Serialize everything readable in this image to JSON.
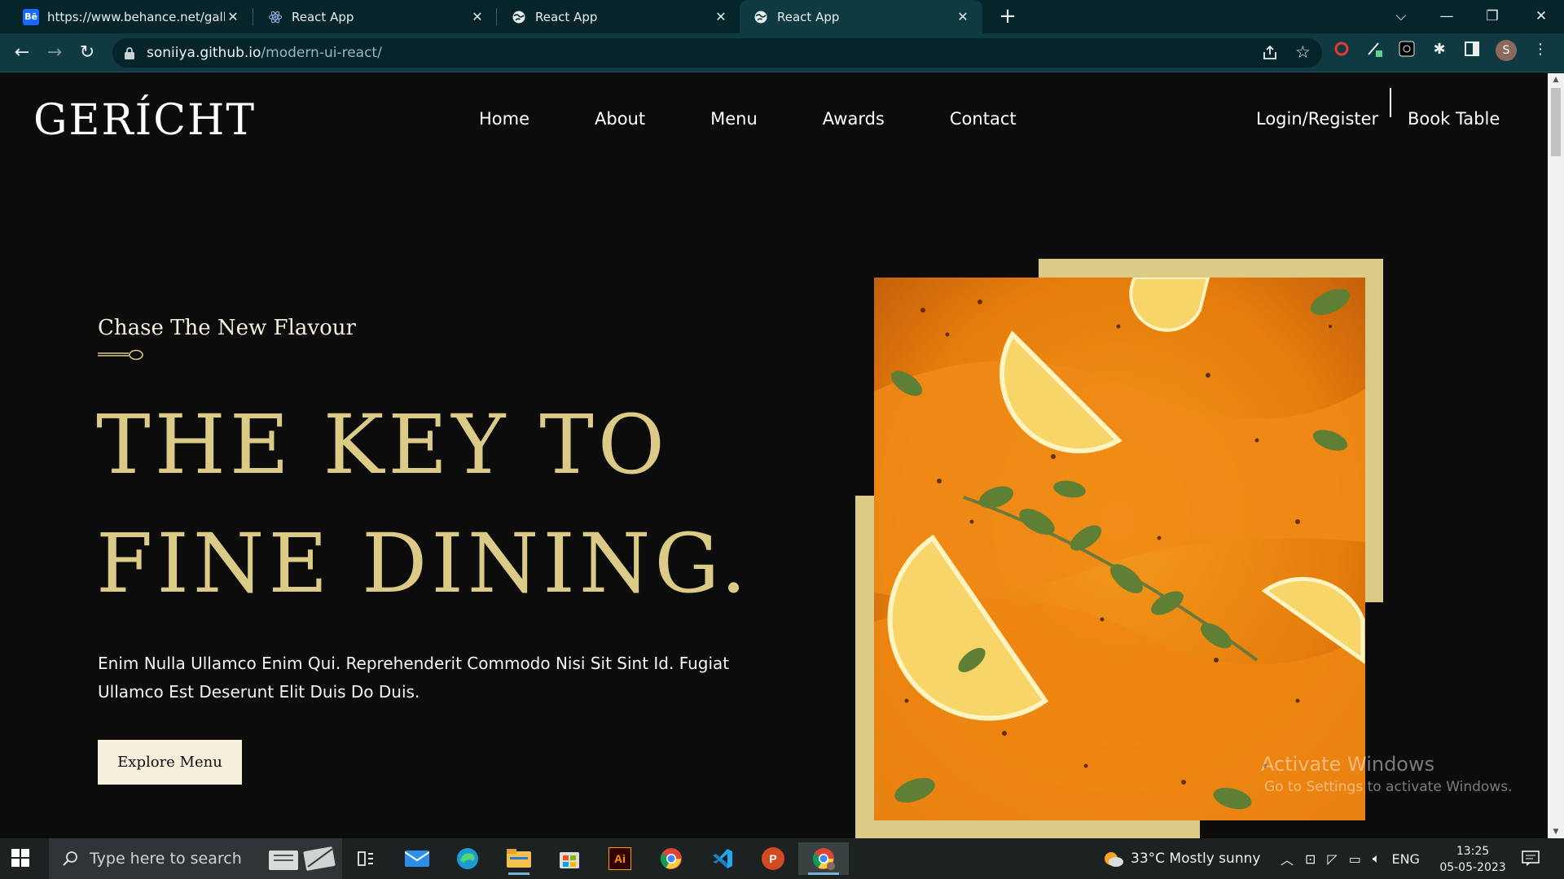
{
  "browser": {
    "tabs": [
      {
        "favicon": "behance-icon",
        "favicon_text": "Bē",
        "title": "https://www.behance.net/gallery",
        "active": false
      },
      {
        "favicon": "react-icon",
        "title": "React App",
        "active": false
      },
      {
        "favicon": "globe-icon",
        "title": "React App",
        "active": false
      },
      {
        "favicon": "globe-icon",
        "title": "React App",
        "active": true
      }
    ],
    "new_tab": "+",
    "address": {
      "host": "soniiya.github.io",
      "path": "/modern-ui-react/"
    },
    "profile_initial": "S"
  },
  "site": {
    "logo": "GERÍCHT",
    "nav": [
      "Home",
      "About",
      "Menu",
      "Awards",
      "Contact"
    ],
    "login": "Login/Register",
    "book": "Book Table"
  },
  "hero": {
    "subtitle": "Chase The New Flavour",
    "headline_line1": "THE KEY TO",
    "headline_line2": "FINE DINING.",
    "description": "Enim Nulla Ullamco Enim Qui. Reprehenderit Commodo Nisi Sit Sint Id. Fugiat Ullamco Est Deserunt Elit Duis Do Duis.",
    "cta": "Explore Menu",
    "accent_color": "#dcca87",
    "cream_color": "#f5efdb"
  },
  "watermark": {
    "line1": "Activate Windows",
    "line2": "Go to Settings to activate Windows."
  },
  "taskbar": {
    "search_placeholder": "Type here to search",
    "weather": "33°C  Mostly sunny",
    "lang": "ENG",
    "time": "13:25",
    "date": "05-05-2023"
  }
}
